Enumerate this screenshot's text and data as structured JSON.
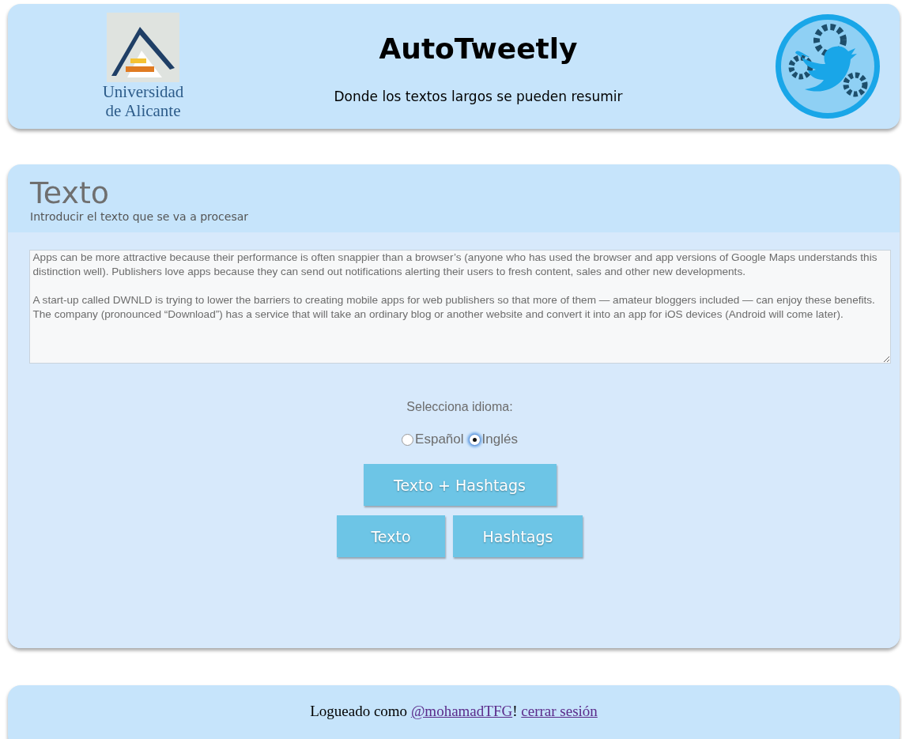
{
  "header": {
    "logo_text": [
      "Universidad",
      "de Alicante"
    ],
    "title": "AutoTweetly",
    "subtitle": "Donde los textos largos se pueden resumir"
  },
  "panel": {
    "title": "Texto",
    "subtitle": "Introducir el texto que se va a procesar",
    "text": "Apps can be more attractive because their performance is often snappier than a browser’s (anyone who has used the browser and app versions of Google Maps understands this distinction well). Publishers love apps because they can send out notifications alerting their users to fresh content, sales and other new developments.\n\nA start-up called DWNLD is trying to lower the barriers to creating mobile apps for web publishers so that more of them — amateur bloggers included — can enjoy these benefits. The company (pronounced “Download”) has a service that will take an ordinary blog or another website and convert it into an app for iOS devices (Android will come later).",
    "language_label": "Selecciona idioma:",
    "languages": [
      {
        "label": "Español",
        "selected": false
      },
      {
        "label": "Inglés",
        "selected": true
      }
    ],
    "buttons": [
      [
        "Texto + Hashtags"
      ],
      [
        "Texto",
        "Hashtags"
      ]
    ]
  },
  "footer": {
    "prefix": "Logueado como ",
    "user_link": "@mohamadTFG",
    "separator": "!",
    "logout_link": "cerrar sesión"
  }
}
